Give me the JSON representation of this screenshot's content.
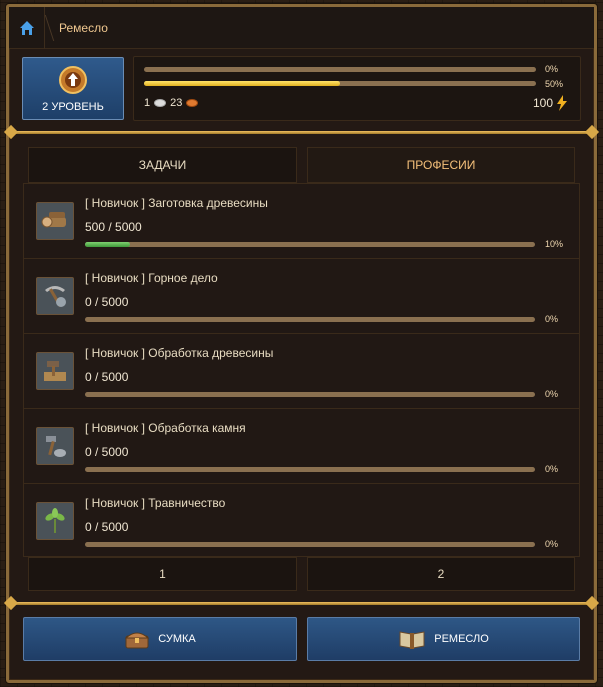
{
  "header": {
    "title": "Ремесло",
    "home_icon": "home-icon"
  },
  "level": {
    "label": "2 УРОВЕНЬ",
    "icon": "level-up-icon"
  },
  "progress": {
    "bar1_pct": "0%",
    "bar1_value": 0,
    "bar2_pct": "50%",
    "bar2_value": 0.5,
    "silver": "1",
    "bronze": "23",
    "energy": "100"
  },
  "tabs": [
    {
      "label": "ЗАДАЧИ",
      "active": false
    },
    {
      "label": "ПРОФЕСИИ",
      "active": true
    }
  ],
  "professions": [
    {
      "name": "[ Новичок ] Заготовка древесины",
      "amount": "500 / 5000",
      "pct": "10%",
      "value": 0.1,
      "icon": "wood-log-icon"
    },
    {
      "name": "[ Новичок ] Горное дело",
      "amount": "0 / 5000",
      "pct": "0%",
      "value": 0,
      "icon": "pickaxe-icon"
    },
    {
      "name": "[ Новичок ] Обработка древесины",
      "amount": "0 / 5000",
      "pct": "0%",
      "value": 0,
      "icon": "hammer-plank-icon"
    },
    {
      "name": "[ Новичок ] Обработка камня",
      "amount": "0 / 5000",
      "pct": "0%",
      "value": 0,
      "icon": "stone-tool-icon"
    },
    {
      "name": "[ Новичок ] Травничество",
      "amount": "0 / 5000",
      "pct": "0%",
      "value": 0,
      "icon": "herb-icon"
    }
  ],
  "pagination": {
    "page1": "1",
    "page2": "2"
  },
  "bottom": {
    "bag_label": "СУМКА",
    "craft_label": "РЕМЕСЛО"
  },
  "colors": {
    "accent_gold": "#f0c060",
    "button_blue": "#2e5786",
    "progress_green": "#5fb850",
    "progress_yellow": "#f0c830"
  }
}
